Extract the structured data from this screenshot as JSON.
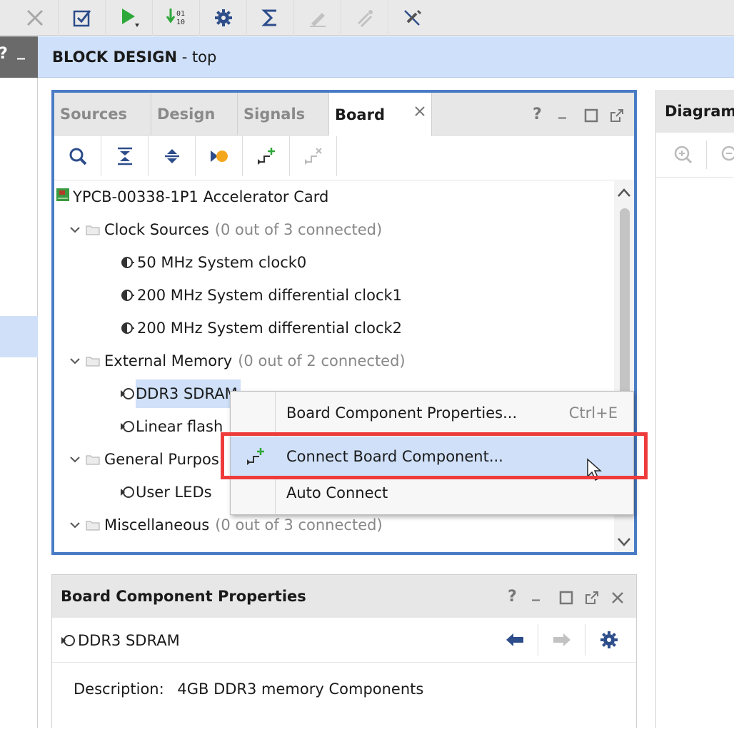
{
  "left_strip": {
    "help": "?",
    "minimize": "_"
  },
  "block_design": {
    "title_bold": "BLOCK DESIGN",
    "title_rest": " - top"
  },
  "board_panel": {
    "tabs": [
      "Sources",
      "Design",
      "Signals",
      "Board"
    ],
    "active_tab": "Board",
    "controls": {
      "help": "?",
      "minimize": "_"
    },
    "tree": {
      "root": "YPCB-00338-1P1 Accelerator Card",
      "groups": [
        {
          "label": "Clock Sources",
          "status": "(0 out of 3 connected)",
          "children": [
            "50 MHz System clock0",
            "200 MHz System differential clock1",
            "200 MHz System differential clock2"
          ]
        },
        {
          "label": "External Memory",
          "status": "(0 out of 2 connected)",
          "children": [
            "DDR3 SDRAM",
            "Linear flash"
          ]
        },
        {
          "label": "General Purpose",
          "children": [
            "User LEDs"
          ]
        },
        {
          "label": "Miscellaneous",
          "status": "(0 out of 3 connected)"
        }
      ],
      "visible": {
        "linear_flash": "Linear flash",
        "general_purpose": "General Purpo",
        "general_purpose_tail": "s"
      }
    }
  },
  "context_menu": {
    "items": [
      {
        "label": "Board Component Properties...",
        "shortcut": "Ctrl+E"
      },
      {
        "label": "Connect Board Component..."
      },
      {
        "label": "Auto Connect"
      }
    ]
  },
  "diagram_panel": {
    "tab": "Diagram"
  },
  "properties_panel": {
    "title": "Board Component Properties",
    "controls": {
      "help": "?",
      "minimize": "_"
    },
    "component": "DDR3 SDRAM",
    "description_label": "Description:",
    "description_value": "4GB DDR3 memory Components"
  },
  "colors": {
    "accent": "#4a7cc6",
    "highlight": "#cfe0f8",
    "callout": "#ee3b3b"
  }
}
